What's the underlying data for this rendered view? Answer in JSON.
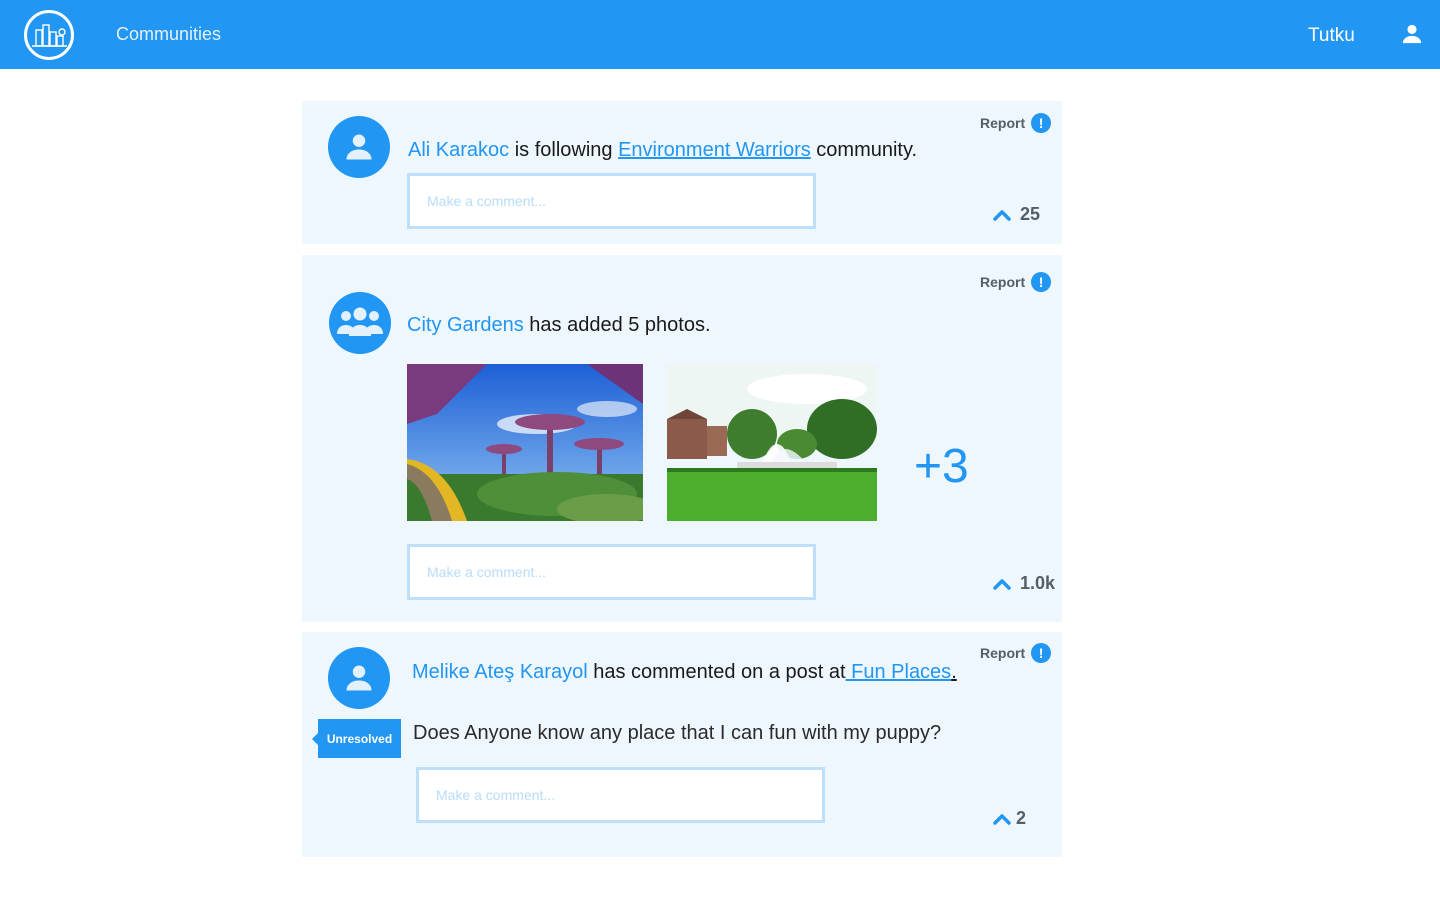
{
  "header": {
    "nav_label": "Communities",
    "user_name": "Tutku",
    "brand_color": "#2196f3"
  },
  "feed": [
    {
      "actor": "Ali Karakoc",
      "action_text": " is following ",
      "link_text": "Environment Warriors",
      "suffix_text": " community.",
      "report_label": "Report",
      "comment_placeholder": "Make a comment...",
      "votes": "25",
      "avatar_icon": "person-icon"
    },
    {
      "actor": "City Gardens",
      "action_text": " has added 5 photos.",
      "report_label": "Report",
      "photos": [
        "supertree-grove-photo",
        "fountain-park-photo"
      ],
      "more_photos": "+3",
      "comment_placeholder": "Make a comment...",
      "votes": "1.0k",
      "avatar_icon": "group-icon"
    },
    {
      "actor": "Melike Ateş Karayol",
      "action_text": " has commented on a post at",
      "link_text": " Fun Places",
      "suffix_text": ".",
      "report_label": "Report",
      "status_badge": "Unresolved",
      "question": "Does Anyone know any place that I can fun with my puppy?",
      "comment_placeholder": "Make a comment...",
      "votes": "2",
      "avatar_icon": "person-icon"
    }
  ]
}
